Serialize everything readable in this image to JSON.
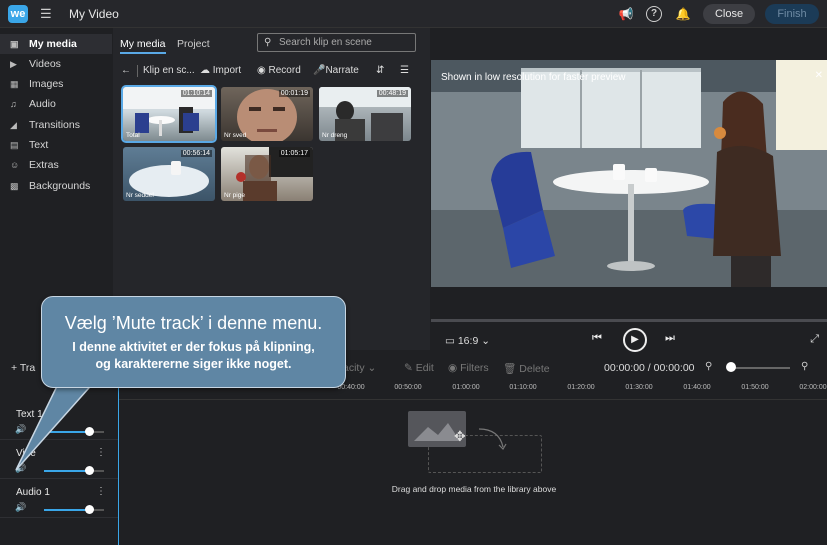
{
  "app": {
    "logo_text": "we",
    "title": "My Video",
    "close_label": "Close",
    "finish_label": "Finish",
    "icons": [
      "menu-icon",
      "megaphone-icon",
      "help-icon",
      "bell-icon"
    ]
  },
  "sidebar": {
    "items": [
      {
        "label": "My media",
        "icon": "my-media-icon"
      },
      {
        "label": "Videos",
        "icon": "videos-icon"
      },
      {
        "label": "Images",
        "icon": "images-icon"
      },
      {
        "label": "Audio",
        "icon": "audio-icon"
      },
      {
        "label": "Transitions",
        "icon": "transitions-icon"
      },
      {
        "label": "Text",
        "icon": "text-icon"
      },
      {
        "label": "Extras",
        "icon": "extras-icon"
      },
      {
        "label": "Backgrounds",
        "icon": "backgrounds-icon"
      }
    ]
  },
  "library": {
    "tabs": [
      "My media",
      "Project"
    ],
    "search_placeholder": "Search klip en scene",
    "folder_label": "Klip en sc...",
    "import_label": "Import",
    "record_label": "Record",
    "narrate_label": "Narrate",
    "clips": [
      {
        "name": "Total",
        "duration": "01:10:14"
      },
      {
        "name": "Nr sved",
        "duration": "00:01:19"
      },
      {
        "name": "Nr dreng",
        "duration": "00:48:19"
      },
      {
        "name": "Nr seddel",
        "duration": "00:56:14"
      },
      {
        "name": "Nr pige",
        "duration": "01:05:17"
      }
    ]
  },
  "preview": {
    "note": "Shown in low resolution for faster preview",
    "aspect_ratio": "16:9"
  },
  "timeline": {
    "add_track_label": "Tra",
    "opacity_label": "acity",
    "edit_label": "Edit",
    "filters_label": "Filters",
    "delete_label": "Delete",
    "timecode": "00:00:00 / 00:00:00",
    "ruler_ticks": [
      "00:40:00",
      "00:50:00",
      "01:00:00",
      "01:10:00",
      "01:20:00",
      "01:30:00",
      "01:40:00",
      "01:50:00",
      "02:00:00"
    ],
    "tracks": [
      {
        "name": "Text 1",
        "volume": 0.75
      },
      {
        "name": "Vide",
        "volume": 0.75
      },
      {
        "name": "Audio 1",
        "volume": 0.75
      }
    ],
    "drop_text": "Drag and drop media from the library above"
  },
  "callout": {
    "title": "Vælg ’Mute track’ i denne menu.",
    "line1": "I denne aktivitet er der fokus på klipning,",
    "line2": "og karaktererne siger ikke noget."
  }
}
